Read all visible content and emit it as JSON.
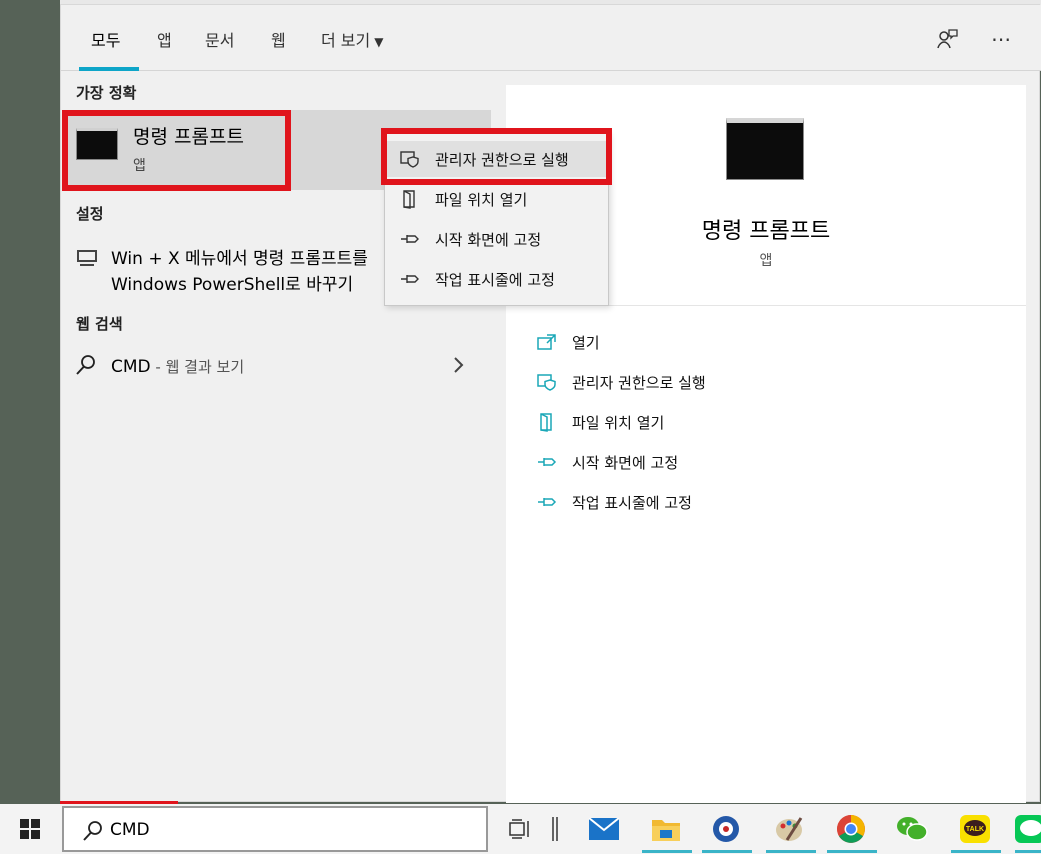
{
  "tabs": {
    "all": "모두",
    "apps": "앱",
    "documents": "문서",
    "web": "웹",
    "more": "더 보기"
  },
  "left": {
    "best_match_title": "가장 정확",
    "best_match": {
      "name": "명령 프롬프트",
      "type": "앱"
    },
    "settings_title": "설정",
    "settings_item_line1": "Win + X 메뉴에서 명령 프롬프트를",
    "settings_item_line2": "Windows PowerShell로 바꾸기",
    "web_title": "웹 검색",
    "web_query": "CMD",
    "web_suffix": " - 웹 결과 보기"
  },
  "context_menu": [
    {
      "label": "관리자 권한으로 실행",
      "icon": "shield-icon"
    },
    {
      "label": "파일 위치 열기",
      "icon": "folder-icon"
    },
    {
      "label": "시작 화면에 고정",
      "icon": "pin-icon"
    },
    {
      "label": "작업 표시줄에 고정",
      "icon": "pin-icon"
    }
  ],
  "preview": {
    "title": "명령 프롬프트",
    "subtitle": "앱",
    "actions": [
      {
        "label": "열기",
        "icon": "open-icon"
      },
      {
        "label": "관리자 권한으로 실행",
        "icon": "shield-icon"
      },
      {
        "label": "파일 위치 열기",
        "icon": "folder-icon"
      },
      {
        "label": "시작 화면에 고정",
        "icon": "pin-icon"
      },
      {
        "label": "작업 표시줄에 고정",
        "icon": "pin-icon"
      }
    ]
  },
  "taskbar": {
    "search_value": "CMD",
    "apps": [
      "task-view-icon",
      "mail-icon",
      "file-explorer-icon",
      "phone-app-icon",
      "paint-icon",
      "chrome-icon",
      "wechat-icon",
      "kakaotalk-icon",
      "line-icon"
    ]
  },
  "colors": {
    "accent": "#0ea5c8",
    "highlight_red": "#e0141c",
    "action_icon": "#1aa7b7"
  }
}
